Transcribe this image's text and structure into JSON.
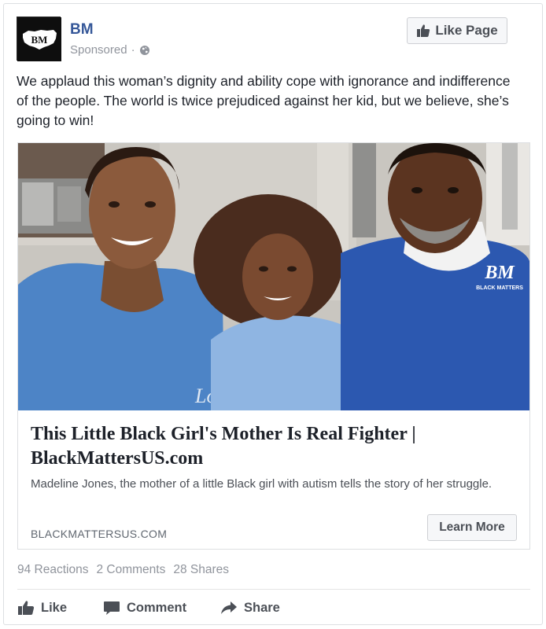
{
  "post": {
    "page_name": "BM",
    "avatar_text": "BM",
    "sponsored_label": "Sponsored",
    "separator": "·",
    "body_text": "We applaud this woman’s dignity and ability cope with ignorance and indifference of the people. The world is twice prejudiced against her kid, but we believe, she’s going to win!",
    "like_page_label": "Like Page"
  },
  "link_preview": {
    "headline": "This Little Black Girl's Mother Is Real Fighter | BlackMattersUS.com",
    "description": "Madeline Jones, the mother of a little Black girl with autism tells the story of her struggle.",
    "domain": "BLACKMATTERSUS.COM",
    "cta_label": "Learn More",
    "photo": {
      "shirt_logo_text": "BM",
      "shirt_logo_subtext": "BLACK MATTERS",
      "shirt_script_text": "Lomey"
    }
  },
  "stats": {
    "reactions": "94 Reactions",
    "comments": "2 Comments",
    "shares": "28 Shares"
  },
  "actions": {
    "like": "Like",
    "comment": "Comment",
    "share": "Share"
  },
  "icons": {
    "like": "thumbs-up-icon",
    "comment": "comment-bubble-icon",
    "share": "share-arrow-icon",
    "audience": "globe-icon"
  },
  "colors": {
    "page_name": "#365899",
    "secondary_text": "#90949c",
    "button_bg": "#f6f7f9"
  }
}
